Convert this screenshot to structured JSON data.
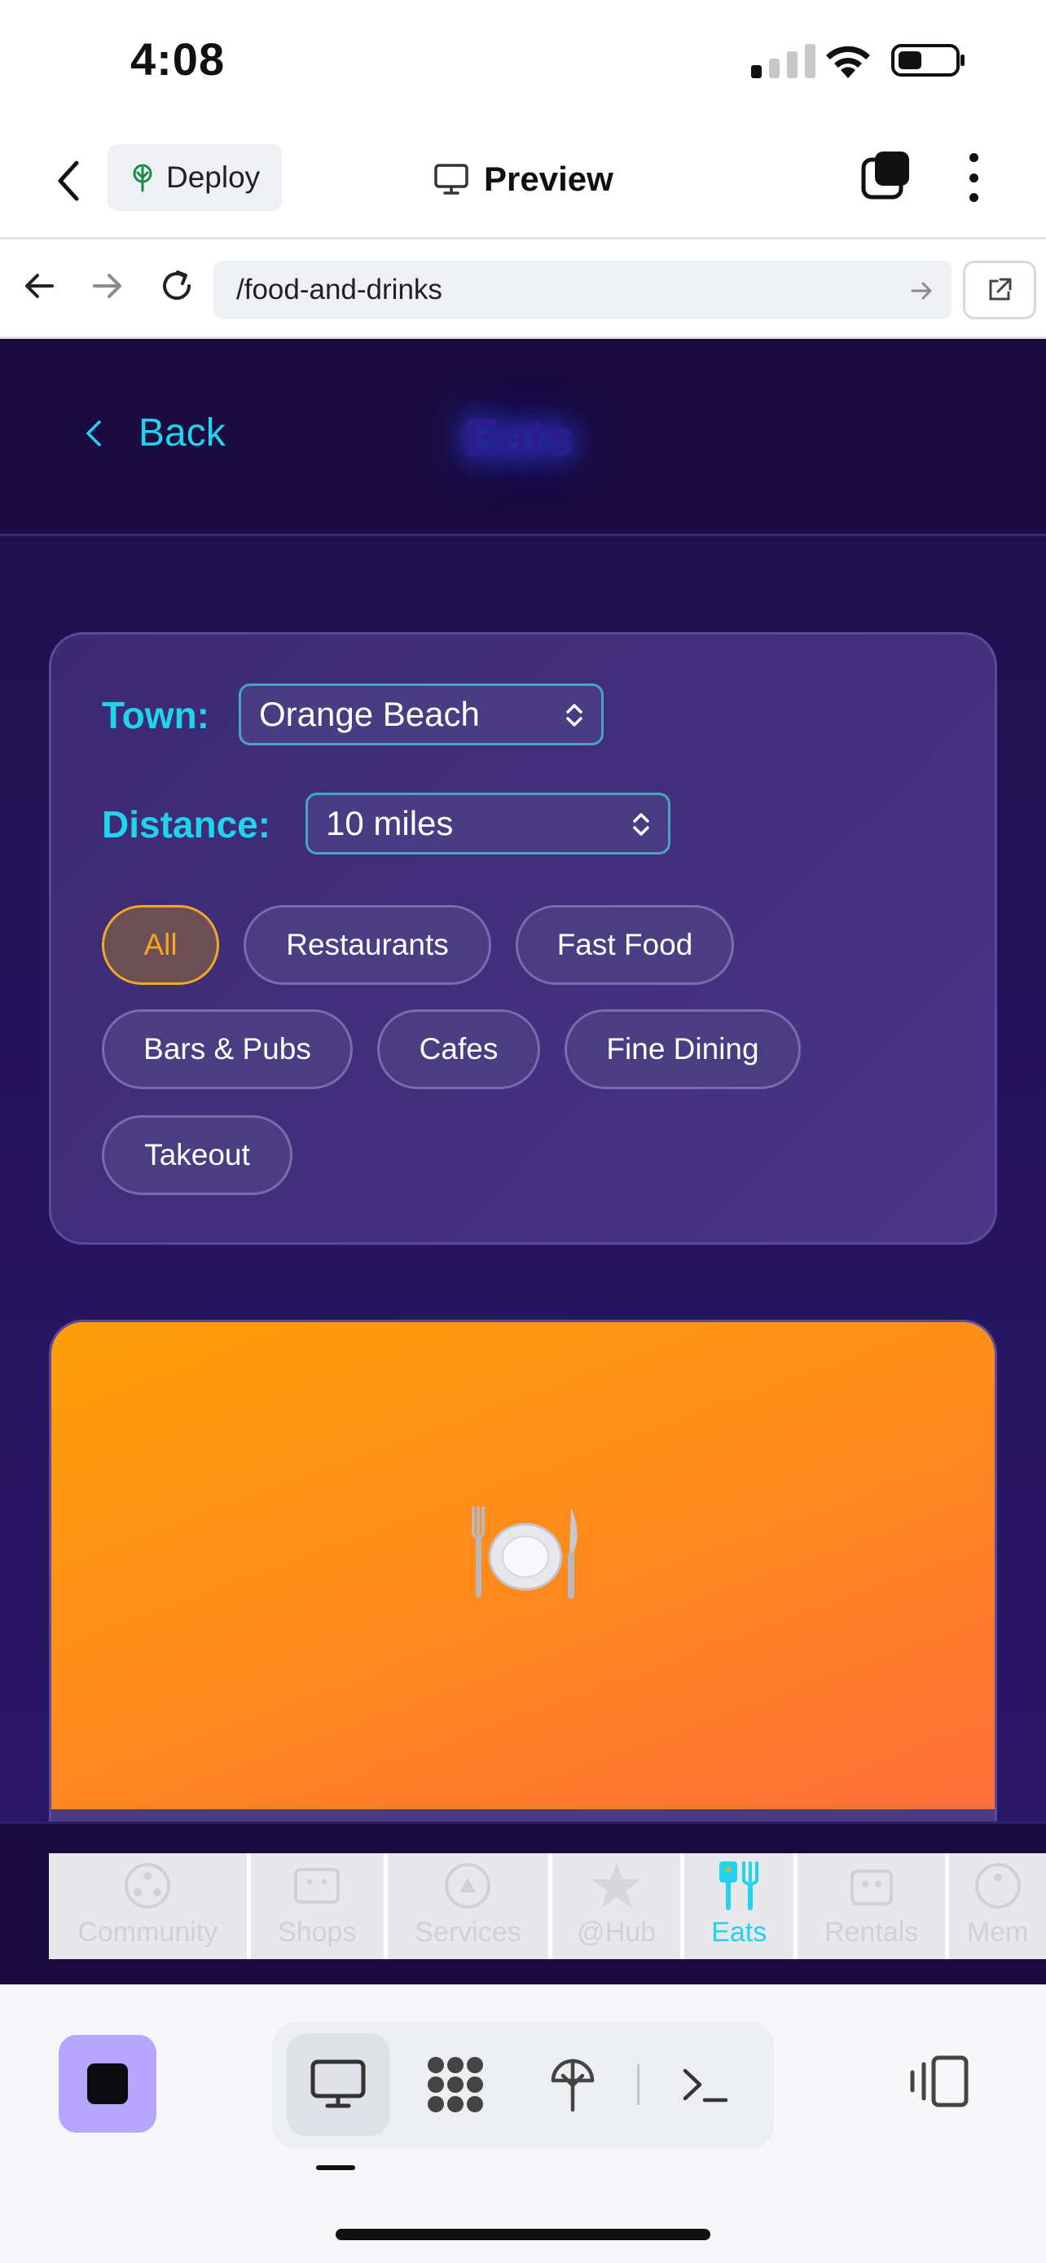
{
  "status_bar": {
    "time": "4:08"
  },
  "app_header": {
    "deploy_label": "Deploy",
    "preview_label": "Preview"
  },
  "url_bar": {
    "url": "/food-and-drinks"
  },
  "site": {
    "back_label": "Back",
    "title": "Eats",
    "filters": {
      "town_label": "Town:",
      "town_value": "Orange Beach",
      "distance_label": "Distance:",
      "distance_value": "10 miles",
      "categories": [
        "All",
        "Restaurants",
        "Fast Food",
        "Bars & Pubs",
        "Cafes",
        "Fine Dining",
        "Takeout"
      ],
      "active_category": "All"
    },
    "card": {
      "image_emoji": "🍽️"
    },
    "nav": {
      "items": [
        {
          "label": "Community",
          "icon": "community-icon"
        },
        {
          "label": "Shops",
          "icon": "shop-icon"
        },
        {
          "label": "Services",
          "icon": "services-icon"
        },
        {
          "label": "@Hub",
          "icon": "star-icon"
        },
        {
          "label": "Eats",
          "icon": "utensils-icon",
          "active": true
        },
        {
          "label": "Rentals",
          "icon": "rentals-icon"
        },
        {
          "label": "Mem",
          "icon": "members-icon"
        }
      ]
    }
  },
  "colors": {
    "accent_cyan": "#22d3ee",
    "active_orange": "#f5a623",
    "bg_purple": "#24145a",
    "stop_purple": "#b7a6ff"
  }
}
